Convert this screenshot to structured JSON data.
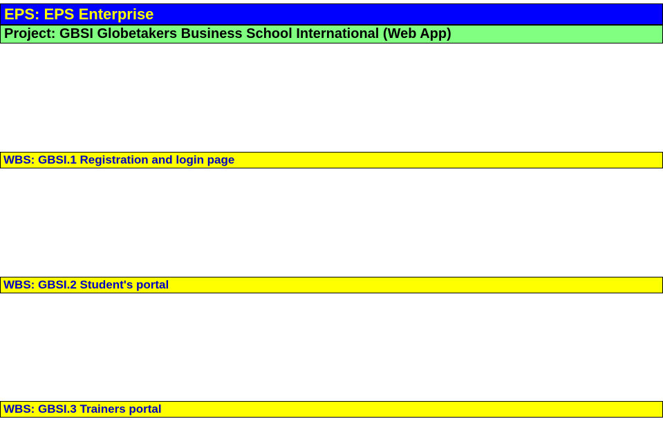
{
  "eps": {
    "label": "EPS: EPS  Enterprise"
  },
  "project": {
    "label": "Project: GBSI  Globetakers Business School International (Web App)"
  },
  "wbs": [
    {
      "label": "WBS: GBSI.1  Registration and login page"
    },
    {
      "label": "WBS: GBSI.2  Student's portal"
    },
    {
      "label": "WBS: GBSI.3  Trainers portal"
    }
  ],
  "colors": {
    "eps_background": "#0000ff",
    "eps_text": "#ffff00",
    "project_background": "#80ff80",
    "project_text": "#000000",
    "wbs_background": "#ffff00",
    "wbs_text": "#0000c0"
  }
}
